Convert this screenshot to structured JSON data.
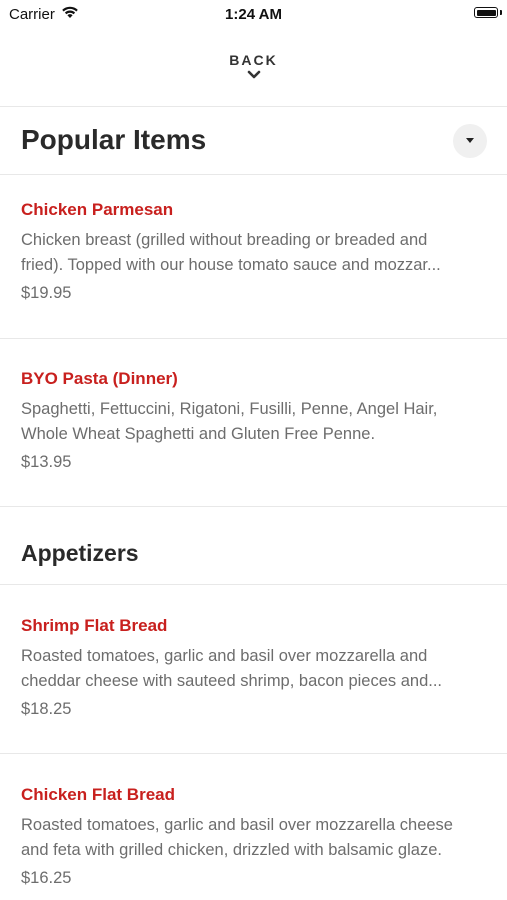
{
  "status_bar": {
    "carrier": "Carrier",
    "time": "1:24 AM"
  },
  "nav": {
    "back_label": "BACK"
  },
  "sections": [
    {
      "title": "Popular Items",
      "items": [
        {
          "name": "Chicken Parmesan",
          "desc_line1": "Chicken breast (grilled without breading or breaded and",
          "desc_line2": "fried). Topped with our house tomato sauce and mozzar...",
          "price": "$19.95"
        },
        {
          "name": "BYO Pasta (Dinner)",
          "desc_line1": "Spaghetti, Fettuccini, Rigatoni, Fusilli, Penne, Angel Hair,",
          "desc_line2": "Whole Wheat Spaghetti and Gluten Free Penne.",
          "price": "$13.95"
        }
      ]
    },
    {
      "title": "Appetizers",
      "items": [
        {
          "name": "Shrimp Flat Bread",
          "desc_line1": "Roasted tomatoes, garlic and basil over mozzarella and",
          "desc_line2": "cheddar cheese with sauteed shrimp, bacon pieces and...",
          "price": "$18.25"
        },
        {
          "name": "Chicken Flat Bread",
          "desc_line1": "Roasted tomatoes, garlic and basil over mozzarella cheese",
          "desc_line2": "and feta with grilled chicken, drizzled with balsamic glaze.",
          "price": "$16.25"
        }
      ]
    }
  ],
  "colors": {
    "item_name": "#c8201e",
    "description": "#6d6d6d",
    "divider": "#e8e8e8"
  },
  "icons": {
    "wifi": "wifi-icon",
    "battery": "battery-icon",
    "back": "chevron-down-icon",
    "dropdown": "caret-down-icon"
  }
}
